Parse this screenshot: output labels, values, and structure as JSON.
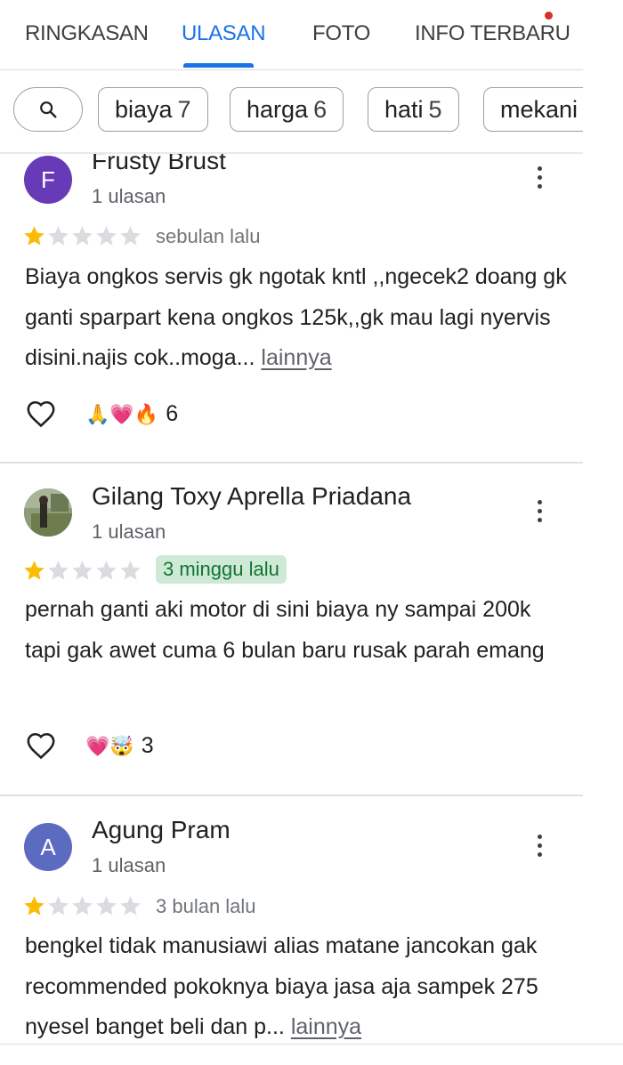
{
  "tabs": [
    {
      "label": "RINGKASAN"
    },
    {
      "label": "ULASAN"
    },
    {
      "label": "FOTO"
    },
    {
      "label": "INFO TERBARU"
    }
  ],
  "active_tab": "ULASAN",
  "chips": [
    {
      "label": "biaya",
      "count": "7"
    },
    {
      "label": "harga",
      "count": "6"
    },
    {
      "label": "hati",
      "count": "5"
    },
    {
      "label": "mekani",
      "count": ""
    }
  ],
  "reviews": [
    {
      "avatar_letter": "F",
      "avatar_color": "#673ab7",
      "name": "Frusty Brust",
      "review_count": "1 ulasan",
      "rating": 1,
      "time": "sebulan lalu",
      "text": "Biaya ongkos servis gk ngotak kntl ,,ngecek2 doang gk ganti sparpart kena ongkos 125k,,gk mau lagi nyervis disini.najis cok..moga...",
      "more": "lainnya",
      "reactions": "🙏💗🔥",
      "reaction_count": "6"
    },
    {
      "avatar_letter": "",
      "avatar_color": "#7a8a6a",
      "name": "Gilang Toxy Aprella Priadana",
      "review_count": "1 ulasan",
      "rating": 1,
      "time": "3 minggu lalu",
      "text": "pernah ganti aki motor di sini biaya ny sampai 200k tapi gak awet cuma 6 bulan baru rusak parah emang",
      "more": "",
      "reactions": "💗🤯",
      "reaction_count": "3"
    },
    {
      "avatar_letter": "A",
      "avatar_color": "#5c6bc0",
      "name": "Agung Pram",
      "review_count": "1 ulasan",
      "rating": 1,
      "time": "3 bulan lalu",
      "text": "bengkel tidak manusiawi alias matane jancokan gak recommended pokoknya biaya jasa aja sampek 275 nyesel banget beli dan p...",
      "more": "lainnya",
      "reactions": "",
      "reaction_count": ""
    }
  ],
  "colors": {
    "accent": "#1a73e8",
    "star_filled": "#fbbc04",
    "star_empty": "#dadce0",
    "badge_bg": "#ceead6",
    "notification_dot": "#d93025"
  }
}
